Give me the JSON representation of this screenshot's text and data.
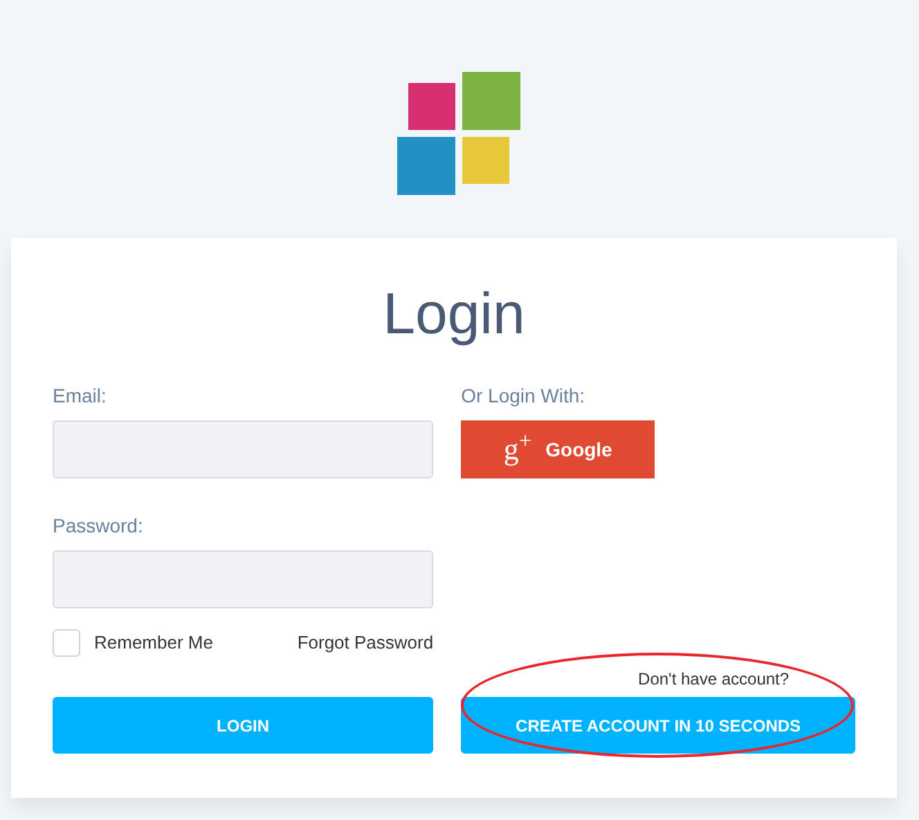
{
  "title": "Login",
  "email": {
    "label": "Email:"
  },
  "password": {
    "label": "Password:"
  },
  "social": {
    "label": "Or Login With:",
    "icon": "g$^{+}$",
    "button": "Google"
  },
  "remember": {
    "label": "Remember Me",
    "checked": false
  },
  "forgot": "Forgot Password",
  "signup_hint": "Don't have account?",
  "login_button": "LOGIN",
  "create_button": "CREATE ACCOUNT IN 10 SECONDS",
  "annotation": {
    "kind": "ellipse",
    "color": "#e8262c"
  }
}
